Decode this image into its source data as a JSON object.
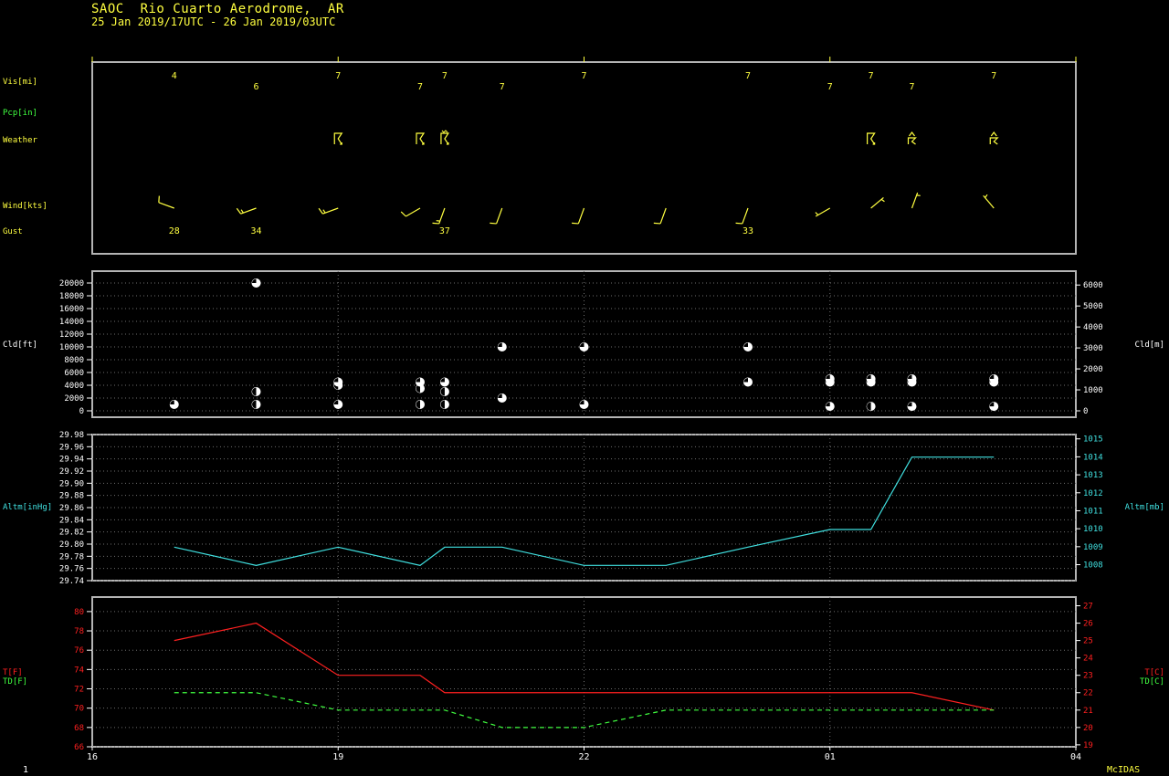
{
  "header": {
    "station": "SAOC  Rio Cuarto Aerodrome,  AR",
    "period": "25 Jan 2019/17UTC - 26 Jan 2019/03UTC"
  },
  "footer": {
    "page": "1",
    "brand": "McIDAS"
  },
  "colors": {
    "background": "#000000",
    "frame": "#b4b4b4",
    "grid": "#6e6e6e",
    "yellow": "#ffff40",
    "green": "#40ff40",
    "cyan": "#40e0e0",
    "red": "#ff2020",
    "white": "#ffffff"
  },
  "chart_data": [
    {
      "type": "table",
      "panel": "surface-obs",
      "row_labels": [
        "Vis[mi]",
        "Pcp[in]",
        "Weather",
        "Wind[kts]",
        "Gust"
      ],
      "x_range": [
        16,
        28
      ],
      "grid_hours": [
        19,
        22,
        25
      ],
      "visibility": [
        {
          "x": 17.0,
          "v": "4",
          "row": "up"
        },
        {
          "x": 18.0,
          "v": "6",
          "row": "down"
        },
        {
          "x": 19.0,
          "v": "7",
          "row": "up"
        },
        {
          "x": 20.0,
          "v": "7",
          "row": "down"
        },
        {
          "x": 20.3,
          "v": "7",
          "row": "up"
        },
        {
          "x": 21.0,
          "v": "7",
          "row": "down"
        },
        {
          "x": 22.0,
          "v": "7",
          "row": "up"
        },
        {
          "x": 24.0,
          "v": "7",
          "row": "up"
        },
        {
          "x": 25.0,
          "v": "7",
          "row": "down"
        },
        {
          "x": 25.5,
          "v": "7",
          "row": "up"
        },
        {
          "x": 26.0,
          "v": "7",
          "row": "down"
        },
        {
          "x": 27.0,
          "v": "7",
          "row": "up"
        }
      ],
      "weather": [
        {
          "x": 19.0,
          "symbol": "thunderstorm"
        },
        {
          "x": 20.0,
          "symbol": "thunderstorm"
        },
        {
          "x": 20.3,
          "symbol": "thunderstorm-rain"
        },
        {
          "x": 25.5,
          "symbol": "thunderstorm"
        },
        {
          "x": 26.0,
          "symbol": "thunderstorm-distant"
        },
        {
          "x": 27.0,
          "symbol": "thunderstorm-distant"
        }
      ],
      "wind": [
        {
          "x": 17.0,
          "dir": 290,
          "spd": 10
        },
        {
          "x": 18.0,
          "dir": 250,
          "spd": 15
        },
        {
          "x": 19.0,
          "dir": 250,
          "spd": 15
        },
        {
          "x": 20.0,
          "dir": 240,
          "spd": 10
        },
        {
          "x": 20.3,
          "dir": 200,
          "spd": 15
        },
        {
          "x": 21.0,
          "dir": 200,
          "spd": 10
        },
        {
          "x": 22.0,
          "dir": 200,
          "spd": 10
        },
        {
          "x": 23.0,
          "dir": 200,
          "spd": 10
        },
        {
          "x": 24.0,
          "dir": 200,
          "spd": 10
        },
        {
          "x": 25.0,
          "dir": 240,
          "spd": 5
        },
        {
          "x": 25.5,
          "dir": 50,
          "spd": 5
        },
        {
          "x": 26.0,
          "dir": 20,
          "spd": 5
        },
        {
          "x": 27.0,
          "dir": 320,
          "spd": 5
        }
      ],
      "gust": [
        {
          "x": 17.0,
          "v": "28"
        },
        {
          "x": 18.0,
          "v": "34"
        },
        {
          "x": 20.3,
          "v": "37"
        },
        {
          "x": 24.0,
          "v": "33"
        }
      ]
    },
    {
      "type": "scatter",
      "panel": "cloud",
      "ylabel": "Cld[ft]",
      "y2label": "Cld[m]",
      "ylim": [
        0,
        21000
      ],
      "yticks": [
        0,
        2000,
        4000,
        6000,
        8000,
        10000,
        12000,
        14000,
        16000,
        18000,
        20000
      ],
      "y2ticks": [
        0,
        1000,
        2000,
        3000,
        4000,
        5000,
        6000
      ],
      "points": [
        {
          "x": 17.0,
          "y": 1000,
          "cover": 0.75
        },
        {
          "x": 18.0,
          "y": 1000,
          "cover": 0.5
        },
        {
          "x": 18.0,
          "y": 3000,
          "cover": 0.5
        },
        {
          "x": 18.0,
          "y": 20000,
          "cover": 0.75
        },
        {
          "x": 19.0,
          "y": 1000,
          "cover": 0.75
        },
        {
          "x": 19.0,
          "y": 4000,
          "cover": 0.5
        },
        {
          "x": 19.0,
          "y": 4500,
          "cover": 0.75
        },
        {
          "x": 20.0,
          "y": 1000,
          "cover": 0.5
        },
        {
          "x": 20.0,
          "y": 3500,
          "cover": 0.5
        },
        {
          "x": 20.0,
          "y": 4500,
          "cover": 0.75
        },
        {
          "x": 20.3,
          "y": 1000,
          "cover": 0.5
        },
        {
          "x": 20.3,
          "y": 3000,
          "cover": 0.5
        },
        {
          "x": 20.3,
          "y": 4500,
          "cover": 0.75
        },
        {
          "x": 21.0,
          "y": 2000,
          "cover": 0.25
        },
        {
          "x": 21.0,
          "y": 10000,
          "cover": 0.75
        },
        {
          "x": 22.0,
          "y": 1000,
          "cover": 0.25
        },
        {
          "x": 22.0,
          "y": 10000,
          "cover": 0.75
        },
        {
          "x": 24.0,
          "y": 4500,
          "cover": 0.25
        },
        {
          "x": 24.0,
          "y": 10000,
          "cover": 0.75
        },
        {
          "x": 25.0,
          "y": 700,
          "cover": 0.25
        },
        {
          "x": 25.0,
          "y": 4500,
          "cover": 0.75
        },
        {
          "x": 25.0,
          "y": 5000,
          "cover": 0.75
        },
        {
          "x": 25.5,
          "y": 700,
          "cover": 0.5
        },
        {
          "x": 25.5,
          "y": 4500,
          "cover": 0.75
        },
        {
          "x": 25.5,
          "y": 5000,
          "cover": 0.75
        },
        {
          "x": 26.0,
          "y": 700,
          "cover": 0.25
        },
        {
          "x": 26.0,
          "y": 4500,
          "cover": 0.75
        },
        {
          "x": 26.0,
          "y": 5000,
          "cover": 0.75
        },
        {
          "x": 27.0,
          "y": 700,
          "cover": 0.25
        },
        {
          "x": 27.0,
          "y": 4500,
          "cover": 0.75
        },
        {
          "x": 27.0,
          "y": 5000,
          "cover": 0.75
        }
      ]
    },
    {
      "type": "line",
      "panel": "altimeter",
      "ylabel": "Altm[inHg]",
      "y2label": "Altm[mb]",
      "ylim": [
        29.74,
        29.98
      ],
      "yticks": [
        29.74,
        29.76,
        29.78,
        29.8,
        29.82,
        29.84,
        29.86,
        29.88,
        29.9,
        29.92,
        29.94,
        29.96,
        29.98
      ],
      "y2ticks": [
        1008,
        1009,
        1010,
        1011,
        1012,
        1013,
        1014,
        1015
      ],
      "x": [
        17.0,
        18.0,
        19.0,
        20.0,
        20.3,
        21.0,
        22.0,
        23.0,
        24.0,
        25.0,
        25.5,
        26.0,
        27.0
      ],
      "values": [
        29.795,
        29.765,
        29.795,
        29.765,
        29.795,
        29.795,
        29.765,
        29.765,
        29.795,
        29.824,
        29.824,
        29.943,
        29.943
      ]
    },
    {
      "type": "line",
      "panel": "temperature",
      "ylim": [
        66,
        81.5
      ],
      "yticks": [
        66,
        68,
        70,
        72,
        74,
        76,
        78,
        80
      ],
      "y2ticks": [
        19,
        20,
        21,
        22,
        23,
        24,
        25,
        26,
        27
      ],
      "left_labels": [
        "T[F]",
        "TD[F]"
      ],
      "right_labels": [
        "T[C]",
        "TD[C]"
      ],
      "xticks": [
        "16",
        "19",
        "22",
        "01",
        "04"
      ],
      "x": [
        17.0,
        18.0,
        19.0,
        20.0,
        20.3,
        21.0,
        22.0,
        23.0,
        24.0,
        25.0,
        25.5,
        26.0,
        27.0
      ],
      "series": [
        {
          "name": "T[F]",
          "values": [
            77.0,
            78.8,
            73.4,
            73.4,
            71.6,
            71.6,
            71.6,
            71.6,
            71.6,
            71.6,
            71.6,
            71.6,
            69.8
          ]
        },
        {
          "name": "TD[F]",
          "values": [
            71.6,
            71.6,
            69.8,
            69.8,
            69.8,
            68.0,
            68.0,
            69.8,
            69.8,
            69.8,
            69.8,
            69.8,
            69.8
          ]
        }
      ]
    }
  ]
}
